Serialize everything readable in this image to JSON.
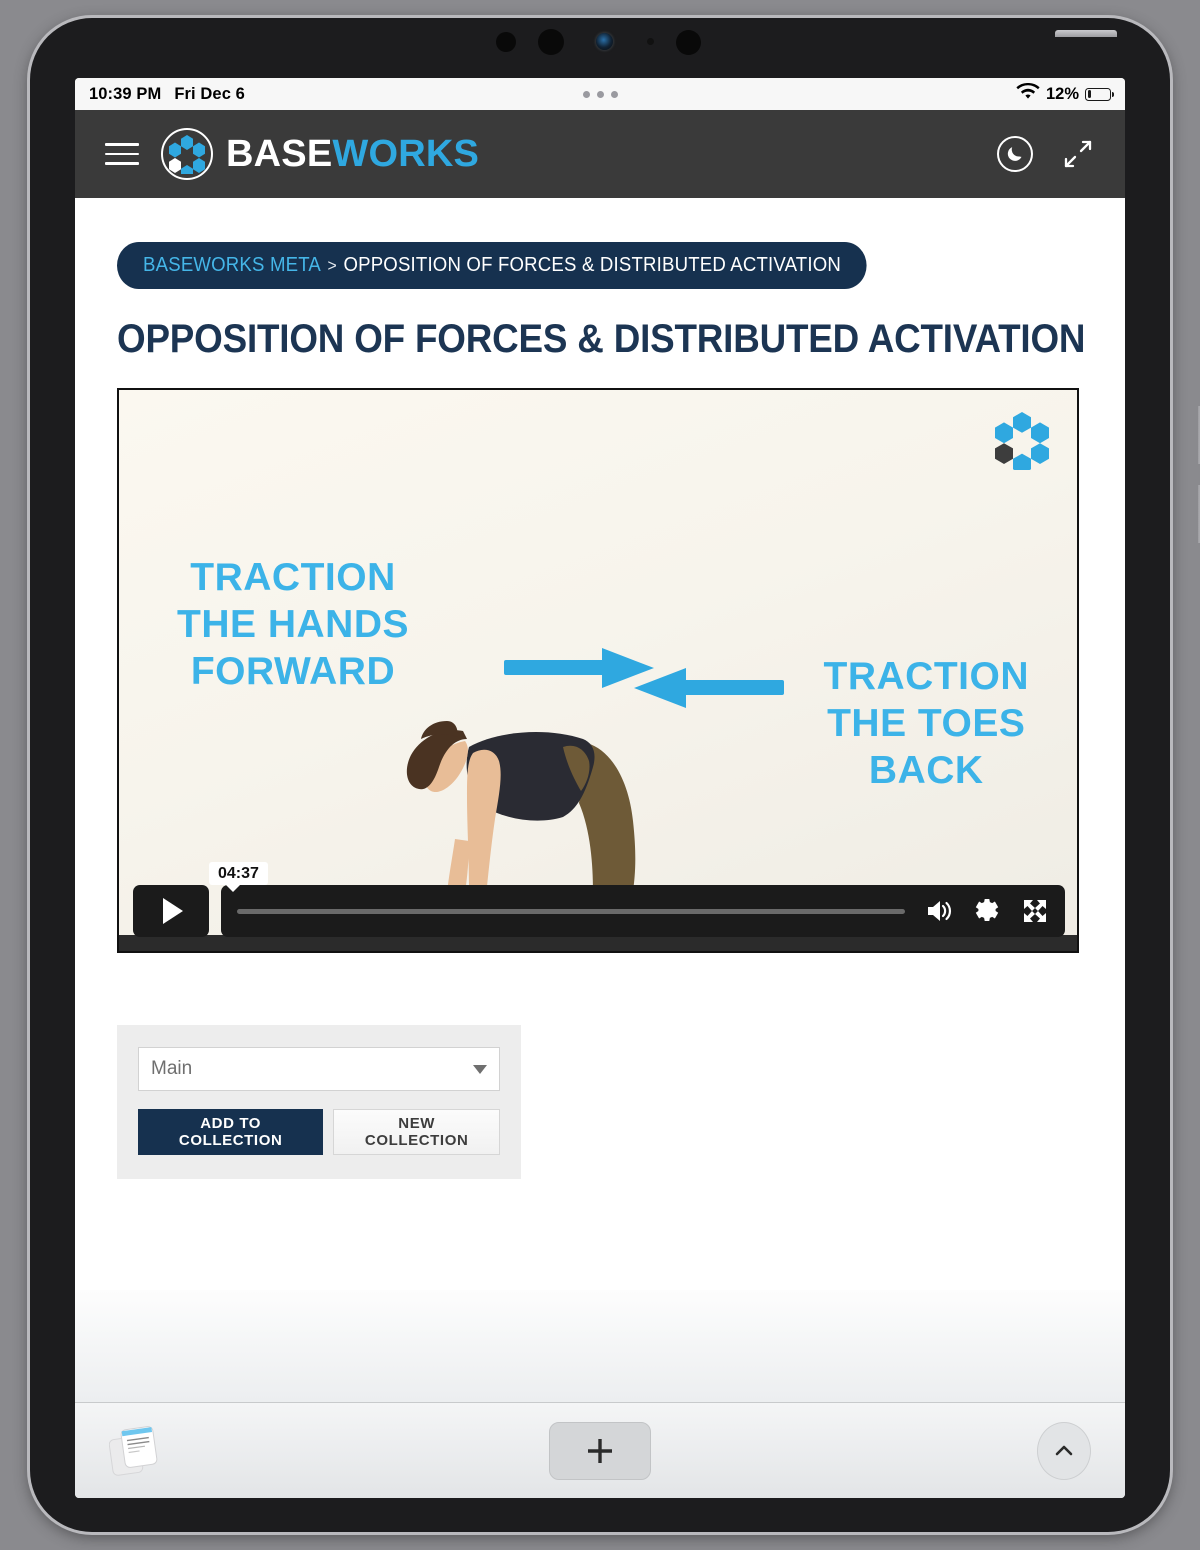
{
  "status_bar": {
    "time": "10:39 PM",
    "date": "Fri Dec 6",
    "battery_percent": "12%",
    "wifi_icon": "wifi-icon",
    "battery_icon": "battery-icon"
  },
  "header": {
    "menu_icon": "hamburger-menu-icon",
    "brand_base": "BASE",
    "brand_works": "WORKS",
    "dark_mode_icon": "moon-icon",
    "fullscreen_icon": "expand-arrows-icon",
    "background_color": "#3a3a3a",
    "accent_color": "#2fa8e0"
  },
  "breadcrumb": {
    "root": "BASEWORKS META",
    "separator": ">",
    "current": "OPPOSITION OF FORCES & DISTRIBUTED ACTIVATION",
    "pill_color": "#16314f",
    "root_color": "#45b6e8"
  },
  "page": {
    "title": "OPPOSITION OF FORCES & DISTRIBUTED ACTIVATION",
    "title_color": "#1c3553"
  },
  "video": {
    "overlay_left": [
      "TRACTION",
      "THE HANDS",
      "FORWARD"
    ],
    "overlay_right": [
      "TRACTION",
      "THE TOES",
      "BACK"
    ],
    "overlay_color": "#3cb3e8",
    "watermark_icon": "baseworks-hexagon-logo-icon",
    "controls": {
      "play_icon": "play-icon",
      "time_tooltip": "04:37",
      "volume_icon": "volume-high-icon",
      "settings_icon": "gear-icon",
      "fullscreen_icon": "fullscreen-icon",
      "progress_percent": 0
    }
  },
  "collection": {
    "selected": "Main",
    "options": [
      "Main"
    ],
    "dropdown_icon": "chevron-down-icon",
    "add_label": "ADD TO COLLECTION",
    "new_label": "NEW COLLECTION",
    "primary_color": "#16314f"
  },
  "browser_toolbar": {
    "tabs_icon": "notes-stack-icon",
    "add_icon": "plus-icon",
    "expand_icon": "chevron-up-icon"
  }
}
